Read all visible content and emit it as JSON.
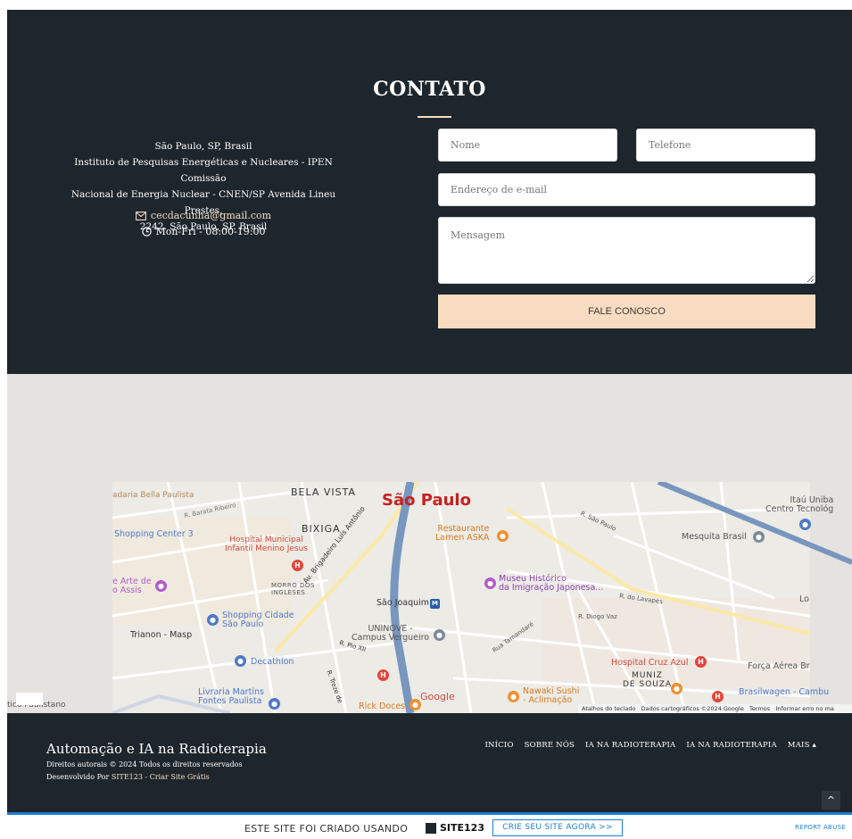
{
  "contact": {
    "title": "CONTATO",
    "address_lines": [
      "São Paulo, SP, Brasil",
      "Instituto de Pesquisas Energéticas e Nucleares - IPEN Comissão",
      "Nacional de Energia Nuclear - CNEN/SP Avenida Lineu Prestes,",
      "2242. São Paulo, SP. Brasil"
    ],
    "email": "cecdacunha@gmail.com",
    "hours": "Mon-Fri - 08:00-19:00",
    "icons": {
      "email": "envelope-icon",
      "hours": "clock-icon"
    },
    "form": {
      "name_placeholder": "Nome",
      "phone_placeholder": "Telefone",
      "email_placeholder": "Endereço de e-mail",
      "message_placeholder": "Mensagem",
      "submit_label": "FALE CONOSCO"
    }
  },
  "map": {
    "labels": {
      "city": "São Paulo",
      "bela_vista": "BELA VISTA",
      "bixiga": "BIXIGA",
      "shopping_center_3": "Shopping Center 3",
      "livraria_bella": "adaria Bella Paulista",
      "r_barata": "R. Barata Ribeiro",
      "hospital_municipal_1": "Hospital Municipal",
      "hospital_municipal_2": "Infantil Menino Jesus",
      "restaurante_1": "Restaurante",
      "restaurante_2": "Lamen ASKA",
      "museu_1": "Museu Histórico",
      "museu_2": "da Imigração Japonesa...",
      "mesquita": "Mesquita Brasil",
      "itau_1": "Itaú Uniba",
      "itau_2": "Centro Tecnológ",
      "arte_1": "e Arte de",
      "arte_2": "o Assis",
      "morro_1": "MORRO DOS",
      "morro_2": "INGLESES",
      "sao_joaquim": "São Joaquim",
      "shopping_cidade_1": "Shopping Cidade",
      "shopping_cidade_2": "São Paulo",
      "trianon": "Trianon - Masp",
      "uninove_1": "UNINOVE -",
      "uninove_2": "Campus Vergueiro",
      "decathlon": "Decathlon",
      "hospital_cruz": "Hospital Cruz Azul",
      "muniz_1": "MUNIZ",
      "muniz_2": "DE SOUZA",
      "forca": "Força Aérea Br",
      "livraria_martins_1": "Livraria Martins",
      "livraria_martins_2": "Fontes Paulista",
      "rick": "Rick Doces",
      "nawaki_1": "Nawaki Sushi",
      "nawaki_2": "- Aclimação",
      "brasilwagen": "Brasilwagen - Cambu",
      "paulistano": "tico Paulistano",
      "av_brigadeiro": "Av. Brigadeiro Luís Antônio",
      "r_diogo": "R. Diogo Vaz",
      "r_lavapes": "R. do Lavapés",
      "r_sao_paulo": "R. São Paulo",
      "r_tamandare": "Rua Tamandaré",
      "r_pio": "R. Pio XII",
      "r_treze": "R. Treze de",
      "lo": "Lo",
      "google": "Google"
    },
    "attribution": {
      "shortcuts": "Atalhos do teclado",
      "data": "Dados cartográficos ©2024 Google",
      "terms": "Termos",
      "report": "Informar erro no ma"
    }
  },
  "footer": {
    "site_name": "Automação e IA na Radioterapia",
    "rights": "Direitos autorais © 2024 Todos os direitos reservados",
    "dev_prefix": "Desenvolvido Por ",
    "dev_link": "SITE123 - Criar Site Grátis",
    "nav": [
      "INÍCIO",
      "SOBRE NÓS",
      "IA NA RADIOTERAPIA",
      "IA NA RADIOTERAPIA",
      "MAIS ▴"
    ],
    "scroll_top": "^"
  },
  "promo": {
    "text": "ESTE SITE FOI CRIADO USANDO",
    "logo": "SITE123",
    "cta": "CRIE SEU SITE AGORA >>",
    "report": "REPORT ABUSE"
  },
  "colors": {
    "dark": "#1d262c",
    "accent": "#f8dcc1",
    "link_blue": "#1d7fd4",
    "map_bg": "#e5e3df"
  }
}
